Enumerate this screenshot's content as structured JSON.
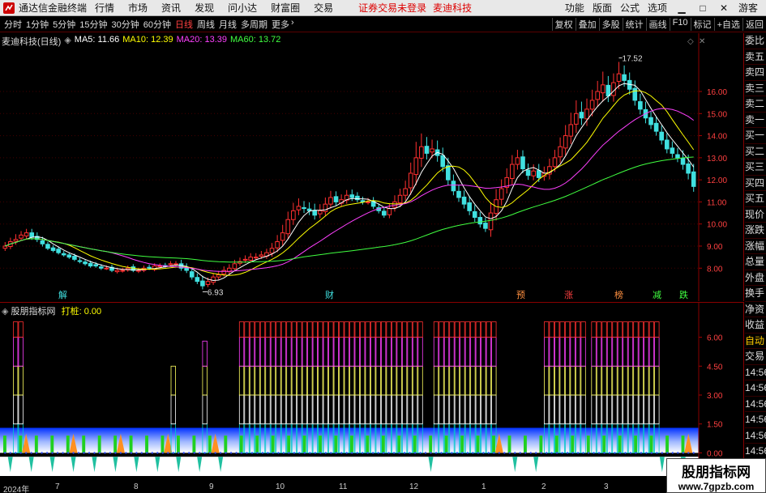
{
  "titlebar": {
    "app_name": "通达信金融终端",
    "menu": [
      "行情",
      "市场",
      "资讯",
      "发现",
      "问小达",
      "财富圈",
      "交易"
    ],
    "login_status": "证券交易未登录",
    "stock_name": "麦迪科技",
    "right_menu": [
      "功能",
      "版面",
      "公式",
      "选项"
    ],
    "guest": "游客"
  },
  "toolbar": {
    "periods": [
      "分时",
      "1分钟",
      "5分钟",
      "15分钟",
      "30分钟",
      "60分钟",
      "日线",
      "周线",
      "月线",
      "多周期",
      "更多"
    ],
    "active_period": "日线",
    "tools": [
      "复权",
      "叠加",
      "多股",
      "统计",
      "画线",
      "F10",
      "标记",
      "+自选",
      "返回"
    ]
  },
  "main_chart": {
    "stock_label": "麦迪科技(日线)",
    "ma": [
      {
        "label": "MA5: 11.66",
        "color": "#ffffff"
      },
      {
        "label": "MA10: 12.39",
        "color": "#ffff00"
      },
      {
        "label": "MA20: 13.39",
        "color": "#ff40ff"
      },
      {
        "label": "MA60: 13.72",
        "color": "#40ff40"
      }
    ],
    "high_label": "17.52",
    "low_label": "6.93",
    "events": [
      {
        "text": "解",
        "color": "#40e0e0"
      },
      {
        "text": "财",
        "color": "#40e0e0"
      },
      {
        "text": "预",
        "color": "#ff9040"
      },
      {
        "text": "涨",
        "color": "#ff4040"
      },
      {
        "text": "榜",
        "color": "#ff9040"
      },
      {
        "text": "减",
        "color": "#40ff40"
      },
      {
        "text": "跌",
        "color": "#40ff40"
      }
    ]
  },
  "chart_data": [
    {
      "type": "candlestick",
      "title": "麦迪科技(日线)",
      "yticks": [
        8.0,
        9.0,
        10.0,
        11.0,
        12.0,
        13.0,
        14.0,
        15.0,
        16.0
      ],
      "ylim": [
        6.8,
        18.2
      ],
      "max_price": 17.52,
      "min_price": 6.93,
      "series": [
        {
          "name": "MA5",
          "value": 11.66
        },
        {
          "name": "MA10",
          "value": 12.39
        },
        {
          "name": "MA20",
          "value": 13.39
        },
        {
          "name": "MA60",
          "value": 13.72
        }
      ],
      "close": [
        9.0,
        9.2,
        9.3,
        9.5,
        9.6,
        9.4,
        9.3,
        9.1,
        8.9,
        8.8,
        8.7,
        8.6,
        8.5,
        8.4,
        8.3,
        8.2,
        8.1,
        8.1,
        8.0,
        8.0,
        7.9,
        7.9,
        7.9,
        8.0,
        7.9,
        7.9,
        8.0,
        8.0,
        8.1,
        8.1,
        8.1,
        8.2,
        8.2,
        8.0,
        7.9,
        7.6,
        7.4,
        7.2,
        7.4,
        7.6,
        7.7,
        7.9,
        8.0,
        8.2,
        8.3,
        8.4,
        8.5,
        8.5,
        8.6,
        8.7,
        8.9,
        9.2,
        9.6,
        10.2,
        10.6,
        10.8,
        10.7,
        10.6,
        10.4,
        10.6,
        10.9,
        11.2,
        11.0,
        11.1,
        11.3,
        11.2,
        11.1,
        11.0,
        11.0,
        10.8,
        10.6,
        10.4,
        10.7,
        11.0,
        11.3,
        11.6,
        12.3,
        13.0,
        13.5,
        13.2,
        13.4,
        13.1,
        12.6,
        12.0,
        11.5,
        11.2,
        10.9,
        10.6,
        10.3,
        10.0,
        9.8,
        10.5,
        11.1,
        11.6,
        12.1,
        12.7,
        13.0,
        12.5,
        12.2,
        12.4,
        12.1,
        12.3,
        12.6,
        13.0,
        13.5,
        14.0,
        14.5,
        15.0,
        14.8,
        15.2,
        15.6,
        16.0,
        16.3,
        15.8,
        16.4,
        16.8,
        16.5,
        16.1,
        15.6,
        15.2,
        14.8,
        14.5,
        14.2,
        13.8,
        13.4,
        13.2,
        13.0,
        12.7,
        12.3,
        11.7
      ],
      "volatility": [
        0.3,
        0.3,
        0.4,
        0.3,
        0.3,
        0.3,
        0.3,
        0.3,
        0.2,
        0.2,
        0.2,
        0.2,
        0.2,
        0.2,
        0.2,
        0.2,
        0.2,
        0.2,
        0.2,
        0.2,
        0.2,
        0.2,
        0.2,
        0.2,
        0.2,
        0.2,
        0.2,
        0.2,
        0.2,
        0.2,
        0.2,
        0.2,
        0.2,
        0.3,
        0.3,
        0.3,
        0.3,
        0.4,
        0.3,
        0.3,
        0.3,
        0.3,
        0.3,
        0.3,
        0.3,
        0.3,
        0.3,
        0.3,
        0.3,
        0.3,
        0.4,
        0.5,
        0.6,
        0.6,
        0.6,
        0.6,
        0.5,
        0.5,
        0.5,
        0.5,
        0.5,
        0.5,
        0.4,
        0.4,
        0.4,
        0.4,
        0.3,
        0.3,
        0.3,
        0.3,
        0.3,
        0.3,
        0.4,
        0.5,
        0.5,
        0.6,
        0.8,
        1.2,
        1.0,
        0.7,
        0.7,
        0.7,
        0.6,
        0.6,
        0.5,
        0.5,
        0.5,
        0.5,
        0.5,
        0.4,
        0.4,
        0.8,
        0.8,
        0.7,
        0.7,
        0.7,
        0.6,
        0.5,
        0.5,
        0.5,
        0.5,
        0.5,
        0.6,
        0.6,
        0.7,
        0.8,
        0.9,
        1.0,
        0.8,
        0.8,
        0.8,
        0.8,
        1.0,
        0.7,
        0.7,
        0.9,
        0.7,
        0.6,
        0.6,
        0.6,
        0.6,
        0.5,
        0.5,
        0.5,
        0.5,
        0.5,
        0.5,
        0.6,
        0.7,
        0.6
      ]
    },
    {
      "type": "bar",
      "title": "股朋指标网",
      "subtitle": "打桩: 0.00",
      "yticks": [
        0.0,
        1.5,
        3.0,
        4.5,
        6.0
      ],
      "ylim": [
        -1.2,
        7.2
      ],
      "levels": [
        0,
        0,
        6,
        6,
        0,
        0,
        0,
        0,
        0,
        0,
        0,
        0,
        0,
        0,
        0,
        0,
        0,
        0,
        0,
        0,
        0,
        0,
        0,
        0,
        0,
        0,
        0,
        0,
        0,
        0,
        0,
        0,
        4,
        0,
        0,
        0,
        0,
        0,
        5,
        0,
        0,
        0,
        0,
        0,
        0,
        6,
        6,
        6,
        6,
        6,
        6,
        6,
        6,
        6,
        6,
        6,
        6,
        6,
        6,
        6,
        6,
        6,
        6,
        6,
        6,
        6,
        6,
        6,
        6,
        6,
        6,
        6,
        6,
        6,
        6,
        6,
        6,
        6,
        6,
        6,
        0,
        0,
        6,
        6,
        6,
        6,
        6,
        6,
        6,
        6,
        6,
        6,
        6,
        6,
        0,
        0,
        0,
        0,
        0,
        0,
        0,
        0,
        0,
        6,
        6,
        6,
        6,
        6,
        6,
        6,
        6,
        0,
        6,
        6,
        6,
        6,
        6,
        6,
        6,
        6,
        6,
        6,
        6,
        6,
        6,
        0,
        0,
        0,
        0,
        0,
        0,
        0
      ]
    }
  ],
  "sidebar": {
    "items": [
      "委比",
      "卖五",
      "卖四",
      "卖三",
      "卖二",
      "卖一",
      "买一",
      "买二",
      "买三",
      "买四",
      "买五",
      "现价",
      "涨跌",
      "涨幅",
      "总量",
      "外盘",
      "换手",
      "净资",
      "收益",
      "自动",
      "交易",
      "14:56",
      "14:56",
      "14:56",
      "14:56",
      "14:56",
      "14:56",
      "14:56"
    ]
  },
  "timeaxis": {
    "labels": [
      "2024年",
      "7",
      "8",
      "9",
      "10",
      "11",
      "12",
      "1",
      "2",
      "3",
      "4"
    ]
  },
  "watermark": {
    "line1": "股朋指标网",
    "line2": "www.7gpzb.com"
  }
}
